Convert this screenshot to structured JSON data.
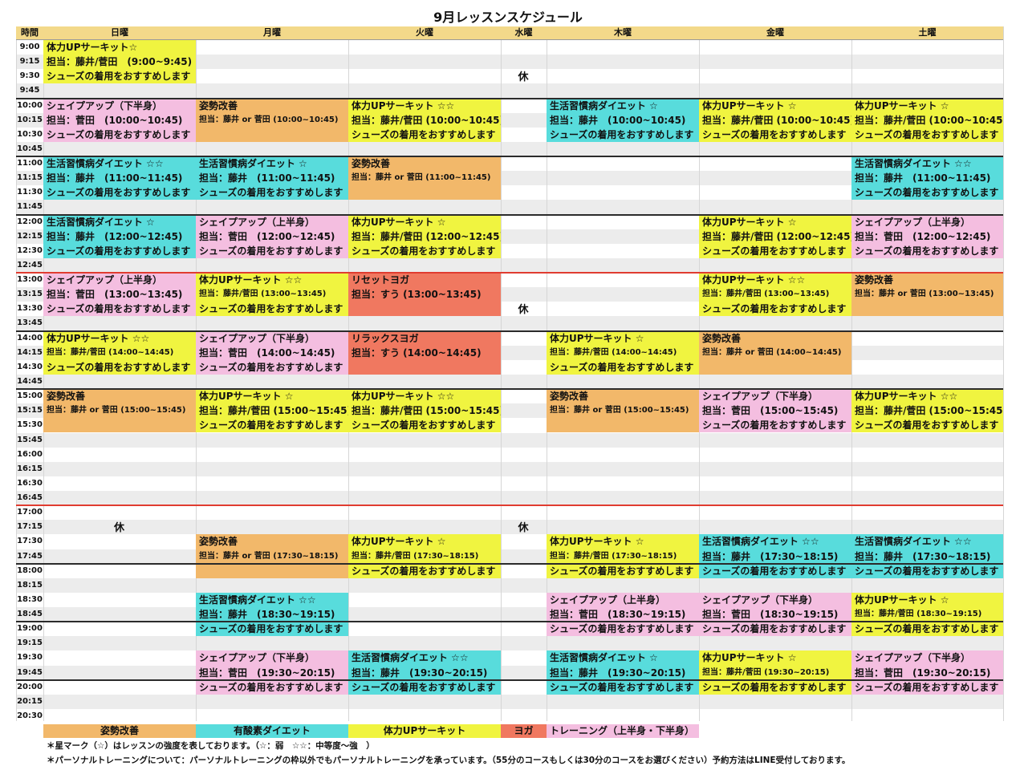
{
  "title": "9月レッスンスケジュール",
  "header": {
    "time": "時間",
    "days": [
      "日曜",
      "月曜",
      "火曜",
      "水曜",
      "木曜",
      "金曜",
      "土曜"
    ]
  },
  "times": [
    "9:00",
    "9:15",
    "9:30",
    "9:45",
    "10:00",
    "10:15",
    "10:30",
    "10:45",
    "11:00",
    "11:15",
    "11:30",
    "11:45",
    "12:00",
    "12:15",
    "12:30",
    "12:45",
    "13:00",
    "13:15",
    "13:30",
    "13:45",
    "14:00",
    "14:15",
    "14:30",
    "14:45",
    "15:00",
    "15:15",
    "15:30",
    "15:45",
    "16:00",
    "16:15",
    "16:30",
    "16:45",
    "17:00",
    "17:15",
    "17:30",
    "17:45",
    "18:00",
    "18:15",
    "18:30",
    "18:45",
    "19:00",
    "19:15",
    "19:30",
    "19:45",
    "20:00",
    "20:15",
    "20:30"
  ],
  "closed_label": "休",
  "colors": {
    "posture": "#f2b86a",
    "aerobic": "#58dcdc",
    "fitness": "#f0f440",
    "yoga": "#f07860",
    "training": "#f4bee0",
    "grid_shade": "#ececec",
    "block_line": "#2b2b2b",
    "red_line": "#e03c30"
  },
  "lessons": [
    {
      "day": 0,
      "start": 0,
      "rows": 3,
      "kind": "fitness",
      "title": "体力UPサーキット☆",
      "staff": "担当：藤井/菅田　(9:00~9:45)",
      "note": "シューズの着用をおすすめします"
    },
    {
      "day": 0,
      "start": 4,
      "rows": 3,
      "kind": "training",
      "title": "シェイプアップ（下半身）",
      "staff": "担当：菅田　(10:00~10:45)",
      "note": "シューズの着用をおすすめします"
    },
    {
      "day": 1,
      "start": 4,
      "rows": 3,
      "kind": "posture",
      "title": "姿勢改善",
      "staff": "担当：藤井 or 菅田 (10:00~10:45)",
      "note": "",
      "small": true
    },
    {
      "day": 2,
      "start": 4,
      "rows": 3,
      "kind": "fitness",
      "title": "体力UPサーキット ☆☆",
      "staff": "担当：藤井/菅田 (10:00~10:45)",
      "note": "シューズの着用をおすすめします"
    },
    {
      "day": 4,
      "start": 4,
      "rows": 3,
      "kind": "aerobic",
      "title": "生活習慣病ダイエット ☆",
      "staff": "担当：藤井　(10:00~10:45)",
      "note": "シューズの着用をおすすめします"
    },
    {
      "day": 5,
      "start": 4,
      "rows": 3,
      "kind": "fitness",
      "title": "体力UPサーキット ☆",
      "staff": "担当：藤井/菅田 (10:00~10:45)",
      "note": "シューズの着用をおすすめします"
    },
    {
      "day": 6,
      "start": 4,
      "rows": 3,
      "kind": "fitness",
      "title": "体力UPサーキット ☆",
      "staff": "担当：藤井/菅田 (10:00~10:45)",
      "note": "シューズの着用をおすすめします"
    },
    {
      "day": 0,
      "start": 8,
      "rows": 3,
      "kind": "aerobic",
      "title": "生活習慣病ダイエット ☆☆",
      "staff": "担当：藤井　(11:00~11:45)",
      "note": "シューズの着用をおすすめします"
    },
    {
      "day": 1,
      "start": 8,
      "rows": 3,
      "kind": "aerobic",
      "title": "生活習慣病ダイエット ☆",
      "staff": "担当：藤井　(11:00~11:45)",
      "note": "シューズの着用をおすすめします"
    },
    {
      "day": 2,
      "start": 8,
      "rows": 3,
      "kind": "posture",
      "title": "姿勢改善",
      "staff": "担当：藤井 or 菅田 (11:00~11:45)",
      "note": "",
      "small": true
    },
    {
      "day": 6,
      "start": 8,
      "rows": 3,
      "kind": "aerobic",
      "title": "生活習慣病ダイエット ☆☆",
      "staff": "担当：藤井　(11:00~11:45)",
      "note": "シューズの着用をおすすめします"
    },
    {
      "day": 0,
      "start": 12,
      "rows": 3,
      "kind": "aerobic",
      "title": "生活習慣病ダイエット ☆",
      "staff": "担当：藤井　(12:00~12:45)",
      "note": "シューズの着用をおすすめします"
    },
    {
      "day": 1,
      "start": 12,
      "rows": 3,
      "kind": "training",
      "title": "シェイプアップ（上半身）",
      "staff": "担当：菅田　(12:00~12:45)",
      "note": "シューズの着用をおすすめします"
    },
    {
      "day": 2,
      "start": 12,
      "rows": 3,
      "kind": "fitness",
      "title": "体力UPサーキット ☆",
      "staff": "担当：藤井/菅田 (12:00~12:45)",
      "note": "シューズの着用をおすすめします"
    },
    {
      "day": 5,
      "start": 12,
      "rows": 3,
      "kind": "fitness",
      "title": "体力UPサーキット ☆",
      "staff": "担当：藤井/菅田 (12:00~12:45)",
      "note": "シューズの着用をおすすめします"
    },
    {
      "day": 6,
      "start": 12,
      "rows": 3,
      "kind": "training",
      "title": "シェイプアップ（上半身）",
      "staff": "担当：菅田　(12:00~12:45)",
      "note": "シューズの着用をおすすめします"
    },
    {
      "day": 0,
      "start": 16,
      "rows": 3,
      "kind": "training",
      "title": "シェイプアップ（上半身）",
      "staff": "担当：菅田　(13:00~13:45)",
      "note": "シューズの着用をおすすめします"
    },
    {
      "day": 1,
      "start": 16,
      "rows": 3,
      "kind": "fitness",
      "title": "体力UPサーキット ☆☆",
      "staff": "担当：藤井/菅田 (13:00~13:45)",
      "note": "シューズの着用をおすすめします",
      "small": true
    },
    {
      "day": 2,
      "start": 16,
      "rows": 3,
      "kind": "yoga",
      "title": "リセットヨガ",
      "staff": "担当：すう (13:00~13:45)",
      "note": ""
    },
    {
      "day": 5,
      "start": 16,
      "rows": 3,
      "kind": "fitness",
      "title": "体力UPサーキット ☆☆",
      "staff": "担当：藤井/菅田 (13:00~13:45)",
      "note": "シューズの着用をおすすめします",
      "small": true
    },
    {
      "day": 6,
      "start": 16,
      "rows": 3,
      "kind": "posture",
      "title": "姿勢改善",
      "staff": "担当：藤井 or 菅田 (13:00~13:45)",
      "note": "",
      "small": true
    },
    {
      "day": 0,
      "start": 20,
      "rows": 3,
      "kind": "fitness",
      "title": "体力UPサーキット ☆☆",
      "staff": "担当：藤井/菅田 (14:00~14:45)",
      "note": "シューズの着用をおすすめします",
      "small": true
    },
    {
      "day": 1,
      "start": 20,
      "rows": 3,
      "kind": "training",
      "title": "シェイプアップ（下半身）",
      "staff": "担当：菅田　(14:00~14:45)",
      "note": "シューズの着用をおすすめします"
    },
    {
      "day": 2,
      "start": 20,
      "rows": 3,
      "kind": "yoga",
      "title": "リラックスヨガ",
      "staff": "担当：すう (14:00~14:45)",
      "note": ""
    },
    {
      "day": 4,
      "start": 20,
      "rows": 3,
      "kind": "fitness",
      "title": "体力UPサーキット ☆",
      "staff": "担当：藤井/菅田 (14:00~14:45)",
      "note": "シューズの着用をおすすめします",
      "small": true
    },
    {
      "day": 5,
      "start": 20,
      "rows": 3,
      "kind": "posture",
      "title": "姿勢改善",
      "staff": "担当：藤井 or 菅田 (14:00~14:45)",
      "note": "",
      "small": true
    },
    {
      "day": 0,
      "start": 24,
      "rows": 3,
      "kind": "posture",
      "title": "姿勢改善",
      "staff": "担当：藤井 or 菅田 (15:00~15:45)",
      "note": "",
      "small": true
    },
    {
      "day": 1,
      "start": 24,
      "rows": 3,
      "kind": "fitness",
      "title": "体力UPサーキット ☆",
      "staff": "担当：藤井/菅田 (15:00~15:45)",
      "note": "シューズの着用をおすすめします"
    },
    {
      "day": 2,
      "start": 24,
      "rows": 3,
      "kind": "fitness",
      "title": "体力UPサーキット ☆☆",
      "staff": "担当：藤井/菅田 (15:00~15:45)",
      "note": "シューズの着用をおすすめします"
    },
    {
      "day": 4,
      "start": 24,
      "rows": 3,
      "kind": "posture",
      "title": "姿勢改善",
      "staff": "担当：藤井 or 菅田 (15:00~15:45)",
      "note": "",
      "small": true
    },
    {
      "day": 5,
      "start": 24,
      "rows": 3,
      "kind": "training",
      "title": "シェイプアップ（下半身）",
      "staff": "担当：菅田　(15:00~15:45)",
      "note": "シューズの着用をおすすめします"
    },
    {
      "day": 6,
      "start": 24,
      "rows": 3,
      "kind": "fitness",
      "title": "体力UPサーキット ☆☆",
      "staff": "担当：藤井/菅田 (15:00~15:45)",
      "note": "シューズの着用をおすすめします"
    },
    {
      "day": 1,
      "start": 34,
      "rows": 3,
      "kind": "posture",
      "title": "姿勢改善",
      "staff": "担当：藤井 or 菅田 (17:30~18:15)",
      "note": "",
      "small": true
    },
    {
      "day": 2,
      "start": 34,
      "rows": 3,
      "kind": "fitness",
      "title": "体力UPサーキット ☆",
      "staff": "担当：藤井/菅田 (17:30~18:15)",
      "note": "シューズの着用をおすすめします",
      "small": true
    },
    {
      "day": 4,
      "start": 34,
      "rows": 3,
      "kind": "fitness",
      "title": "体力UPサーキット ☆",
      "staff": "担当：藤井/菅田 (17:30~18:15)",
      "note": "シューズの着用をおすすめします",
      "small": true
    },
    {
      "day": 5,
      "start": 34,
      "rows": 3,
      "kind": "aerobic",
      "title": "生活習慣病ダイエット ☆☆",
      "staff": "担当：藤井　(17:30~18:15)",
      "note": "シューズの着用をおすすめします"
    },
    {
      "day": 6,
      "start": 34,
      "rows": 3,
      "kind": "aerobic",
      "title": "生活習慣病ダイエット ☆☆",
      "staff": "担当：藤井　(17:30~18:15)",
      "note": "シューズの着用をおすすめします"
    },
    {
      "day": 1,
      "start": 38,
      "rows": 3,
      "kind": "aerobic",
      "title": "生活習慣病ダイエット ☆☆",
      "staff": "担当：藤井　(18:30~19:15)",
      "note": "シューズの着用をおすすめします"
    },
    {
      "day": 4,
      "start": 38,
      "rows": 3,
      "kind": "training",
      "title": "シェイプアップ（上半身）",
      "staff": "担当：菅田　(18:30~19:15)",
      "note": "シューズの着用をおすすめします"
    },
    {
      "day": 5,
      "start": 38,
      "rows": 3,
      "kind": "training",
      "title": "シェイプアップ（下半身）",
      "staff": "担当：菅田　(18:30~19:15)",
      "note": "シューズの着用をおすすめします"
    },
    {
      "day": 6,
      "start": 38,
      "rows": 3,
      "kind": "fitness",
      "title": "体力UPサーキット ☆",
      "staff": "担当：藤井/菅田 (18:30~19:15)",
      "note": "シューズの着用をおすすめします",
      "small": true
    },
    {
      "day": 1,
      "start": 42,
      "rows": 3,
      "kind": "training",
      "title": "シェイプアップ（下半身）",
      "staff": "担当：菅田　(19:30~20:15)",
      "note": "シューズの着用をおすすめします"
    },
    {
      "day": 2,
      "start": 42,
      "rows": 3,
      "kind": "aerobic",
      "title": "生活習慣病ダイエット ☆☆",
      "staff": "担当：藤井　(19:30~20:15)",
      "note": "シューズの着用をおすすめします"
    },
    {
      "day": 4,
      "start": 42,
      "rows": 3,
      "kind": "aerobic",
      "title": "生活習慣病ダイエット ☆",
      "staff": "担当：藤井　(19:30~20:15)",
      "note": "シューズの着用をおすすめします"
    },
    {
      "day": 5,
      "start": 42,
      "rows": 3,
      "kind": "fitness",
      "title": "体力UPサーキット ☆",
      "staff": "担当：藤井/菅田 (19:30~20:15)",
      "note": "シューズの着用をおすすめします",
      "small": true
    },
    {
      "day": 6,
      "start": 42,
      "rows": 3,
      "kind": "training",
      "title": "シェイプアップ（下半身）",
      "staff": "担当：菅田　(19:30~20:15)",
      "note": "シューズの着用をおすすめします"
    }
  ],
  "closed_marks": [
    {
      "day": 3,
      "row": 2
    },
    {
      "day": 3,
      "row": 18
    },
    {
      "day": 0,
      "row": 33
    },
    {
      "day": 3,
      "row": 33
    }
  ],
  "legend": [
    {
      "label": "姿勢改善",
      "kind": "posture"
    },
    {
      "label": "有酸素ダイエット",
      "kind": "aerobic"
    },
    {
      "label": "体力UPサーキット",
      "kind": "fitness"
    },
    {
      "label": "ヨガ",
      "kind": "yoga"
    },
    {
      "label": "トレーニング（上半身・下半身）",
      "kind": "training"
    }
  ],
  "notes": [
    "＊星マーク（☆）はレッスンの強度を表しております。（☆：弱　☆☆：中等度〜強　）",
    "＊パーソナルトレーニングについて：パーソナルトレーニングの枠以外でもパーソナルトレーニングを承っています。（55分のコースもしくは30分のコースをお選びください）予約方法はLINE受付しております。"
  ]
}
